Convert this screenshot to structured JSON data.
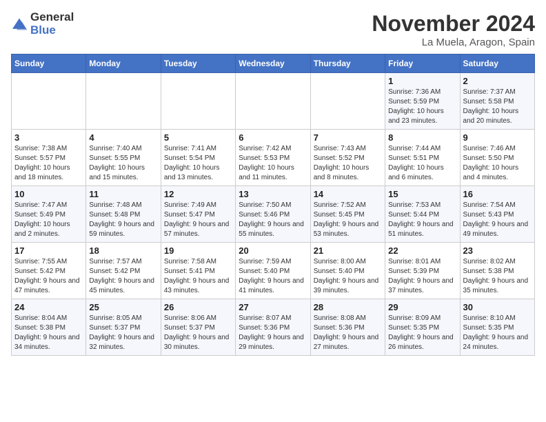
{
  "logo": {
    "line1": "General",
    "line2": "Blue"
  },
  "title": "November 2024",
  "subtitle": "La Muela, Aragon, Spain",
  "weekdays": [
    "Sunday",
    "Monday",
    "Tuesday",
    "Wednesday",
    "Thursday",
    "Friday",
    "Saturday"
  ],
  "weeks": [
    [
      {
        "day": "",
        "info": ""
      },
      {
        "day": "",
        "info": ""
      },
      {
        "day": "",
        "info": ""
      },
      {
        "day": "",
        "info": ""
      },
      {
        "day": "",
        "info": ""
      },
      {
        "day": "1",
        "info": "Sunrise: 7:36 AM\nSunset: 5:59 PM\nDaylight: 10 hours and 23 minutes."
      },
      {
        "day": "2",
        "info": "Sunrise: 7:37 AM\nSunset: 5:58 PM\nDaylight: 10 hours and 20 minutes."
      }
    ],
    [
      {
        "day": "3",
        "info": "Sunrise: 7:38 AM\nSunset: 5:57 PM\nDaylight: 10 hours and 18 minutes."
      },
      {
        "day": "4",
        "info": "Sunrise: 7:40 AM\nSunset: 5:55 PM\nDaylight: 10 hours and 15 minutes."
      },
      {
        "day": "5",
        "info": "Sunrise: 7:41 AM\nSunset: 5:54 PM\nDaylight: 10 hours and 13 minutes."
      },
      {
        "day": "6",
        "info": "Sunrise: 7:42 AM\nSunset: 5:53 PM\nDaylight: 10 hours and 11 minutes."
      },
      {
        "day": "7",
        "info": "Sunrise: 7:43 AM\nSunset: 5:52 PM\nDaylight: 10 hours and 8 minutes."
      },
      {
        "day": "8",
        "info": "Sunrise: 7:44 AM\nSunset: 5:51 PM\nDaylight: 10 hours and 6 minutes."
      },
      {
        "day": "9",
        "info": "Sunrise: 7:46 AM\nSunset: 5:50 PM\nDaylight: 10 hours and 4 minutes."
      }
    ],
    [
      {
        "day": "10",
        "info": "Sunrise: 7:47 AM\nSunset: 5:49 PM\nDaylight: 10 hours and 2 minutes."
      },
      {
        "day": "11",
        "info": "Sunrise: 7:48 AM\nSunset: 5:48 PM\nDaylight: 9 hours and 59 minutes."
      },
      {
        "day": "12",
        "info": "Sunrise: 7:49 AM\nSunset: 5:47 PM\nDaylight: 9 hours and 57 minutes."
      },
      {
        "day": "13",
        "info": "Sunrise: 7:50 AM\nSunset: 5:46 PM\nDaylight: 9 hours and 55 minutes."
      },
      {
        "day": "14",
        "info": "Sunrise: 7:52 AM\nSunset: 5:45 PM\nDaylight: 9 hours and 53 minutes."
      },
      {
        "day": "15",
        "info": "Sunrise: 7:53 AM\nSunset: 5:44 PM\nDaylight: 9 hours and 51 minutes."
      },
      {
        "day": "16",
        "info": "Sunrise: 7:54 AM\nSunset: 5:43 PM\nDaylight: 9 hours and 49 minutes."
      }
    ],
    [
      {
        "day": "17",
        "info": "Sunrise: 7:55 AM\nSunset: 5:42 PM\nDaylight: 9 hours and 47 minutes."
      },
      {
        "day": "18",
        "info": "Sunrise: 7:57 AM\nSunset: 5:42 PM\nDaylight: 9 hours and 45 minutes."
      },
      {
        "day": "19",
        "info": "Sunrise: 7:58 AM\nSunset: 5:41 PM\nDaylight: 9 hours and 43 minutes."
      },
      {
        "day": "20",
        "info": "Sunrise: 7:59 AM\nSunset: 5:40 PM\nDaylight: 9 hours and 41 minutes."
      },
      {
        "day": "21",
        "info": "Sunrise: 8:00 AM\nSunset: 5:40 PM\nDaylight: 9 hours and 39 minutes."
      },
      {
        "day": "22",
        "info": "Sunrise: 8:01 AM\nSunset: 5:39 PM\nDaylight: 9 hours and 37 minutes."
      },
      {
        "day": "23",
        "info": "Sunrise: 8:02 AM\nSunset: 5:38 PM\nDaylight: 9 hours and 35 minutes."
      }
    ],
    [
      {
        "day": "24",
        "info": "Sunrise: 8:04 AM\nSunset: 5:38 PM\nDaylight: 9 hours and 34 minutes."
      },
      {
        "day": "25",
        "info": "Sunrise: 8:05 AM\nSunset: 5:37 PM\nDaylight: 9 hours and 32 minutes."
      },
      {
        "day": "26",
        "info": "Sunrise: 8:06 AM\nSunset: 5:37 PM\nDaylight: 9 hours and 30 minutes."
      },
      {
        "day": "27",
        "info": "Sunrise: 8:07 AM\nSunset: 5:36 PM\nDaylight: 9 hours and 29 minutes."
      },
      {
        "day": "28",
        "info": "Sunrise: 8:08 AM\nSunset: 5:36 PM\nDaylight: 9 hours and 27 minutes."
      },
      {
        "day": "29",
        "info": "Sunrise: 8:09 AM\nSunset: 5:35 PM\nDaylight: 9 hours and 26 minutes."
      },
      {
        "day": "30",
        "info": "Sunrise: 8:10 AM\nSunset: 5:35 PM\nDaylight: 9 hours and 24 minutes."
      }
    ]
  ]
}
